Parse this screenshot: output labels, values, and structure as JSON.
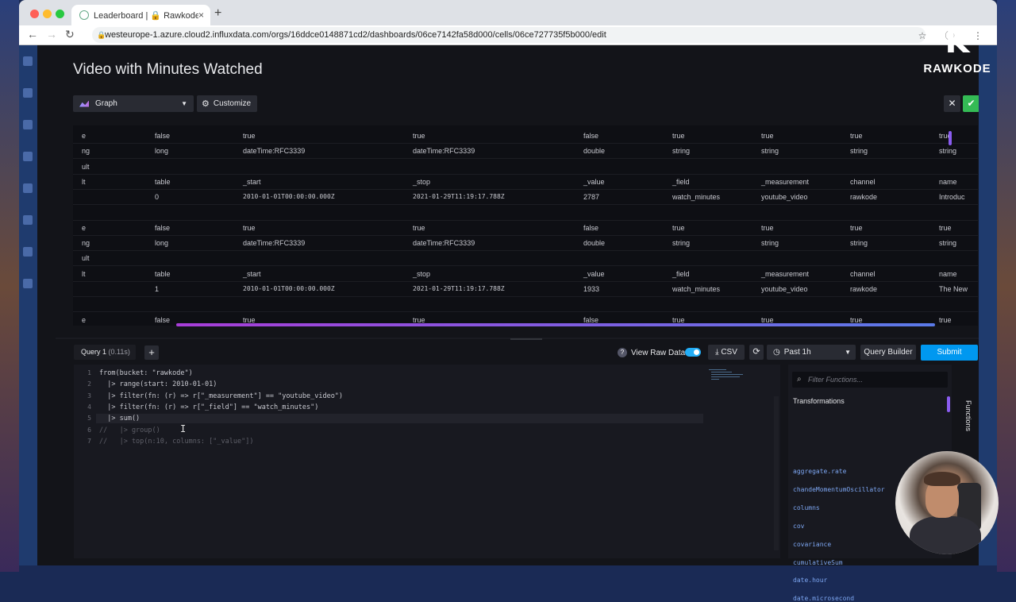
{
  "browser": {
    "tab_title": "Leaderboard | 🔒 Rawkode Te",
    "tab_close": "×",
    "new_tab": "+",
    "url": "westeurope-1.azure.cloud2.influxdata.com/orgs/16ddce0148871cd2/dashboards/06ce7142fa58d000/cells/06ce727735f5b000/edit",
    "traffic_lights": [
      "#fe5f57",
      "#febc2e",
      "#28c840"
    ]
  },
  "logo": {
    "mark": "K",
    "text": "RAWKODE"
  },
  "editor_header": {
    "title": "Video with Minutes Watched",
    "view_type": "Graph",
    "customize_label": "Customize"
  },
  "raw_table": {
    "rows": [
      [
        "e",
        "false",
        "true",
        "true",
        "false",
        "true",
        "true",
        "true",
        "true"
      ],
      [
        "ng",
        "long",
        "dateTime:RFC3339",
        "dateTime:RFC3339",
        "double",
        "string",
        "string",
        "string",
        "string"
      ],
      [
        "ult",
        "",
        "",
        "",
        "",
        "",
        "",
        "",
        ""
      ],
      [
        "lt",
        "table",
        "_start",
        "_stop",
        "_value",
        "_field",
        "_measurement",
        "channel",
        "name"
      ],
      [
        "",
        "0",
        "2010-01-01T00:00:00.000Z",
        "2021-01-29T11:19:17.788Z",
        "2787",
        "watch_minutes",
        "youtube_video",
        "rawkode",
        "Introduc"
      ],
      [
        "",
        "",
        "",
        "",
        "",
        "",
        "",
        "",
        ""
      ],
      [
        "e",
        "false",
        "true",
        "true",
        "false",
        "true",
        "true",
        "true",
        "true"
      ],
      [
        "ng",
        "long",
        "dateTime:RFC3339",
        "dateTime:RFC3339",
        "double",
        "string",
        "string",
        "string",
        "string"
      ],
      [
        "ult",
        "",
        "",
        "",
        "",
        "",
        "",
        "",
        ""
      ],
      [
        "lt",
        "table",
        "_start",
        "_stop",
        "_value",
        "_field",
        "_measurement",
        "channel",
        "name"
      ],
      [
        "",
        "1",
        "2010-01-01T00:00:00.000Z",
        "2021-01-29T11:19:17.788Z",
        "1933",
        "watch_minutes",
        "youtube_video",
        "rawkode",
        "The New"
      ],
      [
        "",
        "",
        "",
        "",
        "",
        "",
        "",
        "",
        ""
      ],
      [
        "e",
        "false",
        "true",
        "true",
        "false",
        "true",
        "true",
        "true",
        "true"
      ]
    ]
  },
  "query_bar": {
    "query_tab": "Query 1",
    "query_time": "(0.11s)",
    "add_label": "+",
    "view_raw_label": "View Raw Data",
    "csv_label": "CSV",
    "time_range": "Past 1h",
    "query_builder_label": "Query Builder",
    "submit_label": "Submit"
  },
  "code_lines": [
    "from(bucket: \"rawkode\")",
    "  |> range(start: 2010-01-01)",
    "  |> filter(fn: (r) => r[\"_measurement\"] == \"youtube_video\")",
    "  |> filter(fn: (r) => r[\"_field\"] == \"watch_minutes\")",
    "  |> sum()",
    "//   |> group()",
    "//   |> top(n:10, columns: [\"_value\"])"
  ],
  "functions_panel": {
    "search_placeholder": "Filter Functions...",
    "section_title": "Transformations",
    "tab_label": "Functions",
    "items": [
      "aggregate.rate",
      "chandeMomentumOscillator",
      "columns",
      "cov",
      "covariance",
      "cumulativeSum",
      "date.hour",
      "date.microsecond"
    ]
  },
  "colors": {
    "accent": "#0098f0",
    "success": "#34bb55",
    "app_bg": "#131419",
    "nav_blue": "#1f3b6e"
  }
}
